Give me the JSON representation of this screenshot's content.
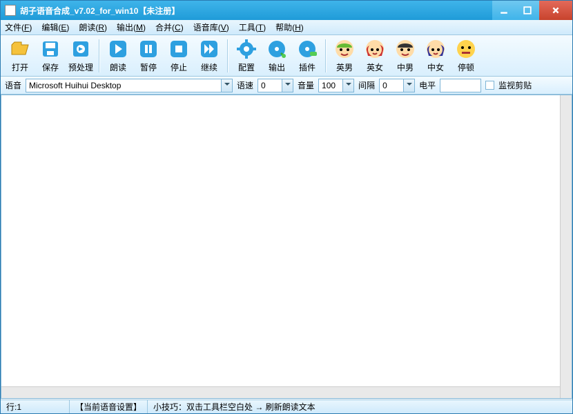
{
  "window": {
    "title": "胡子语音合成_v7.02_for_win10【未注册】"
  },
  "menu": [
    {
      "label": "文件",
      "key": "F"
    },
    {
      "label": "编辑",
      "key": "E"
    },
    {
      "label": "朗读",
      "key": "R"
    },
    {
      "label": "输出",
      "key": "M"
    },
    {
      "label": "合并",
      "key": "C"
    },
    {
      "label": "语音库",
      "key": "V"
    },
    {
      "label": "工具",
      "key": "T"
    },
    {
      "label": "帮助",
      "key": "H"
    }
  ],
  "toolbar": {
    "g1": [
      {
        "n": "打开",
        "i": "open"
      },
      {
        "n": "保存",
        "i": "save"
      },
      {
        "n": "预处理",
        "i": "pre"
      }
    ],
    "g2": [
      {
        "n": "朗读",
        "i": "play"
      },
      {
        "n": "暂停",
        "i": "pause"
      },
      {
        "n": "停止",
        "i": "stop"
      },
      {
        "n": "继续",
        "i": "next"
      }
    ],
    "g3": [
      {
        "n": "配置",
        "i": "gear"
      },
      {
        "n": "输出",
        "i": "disc-out"
      },
      {
        "n": "插件",
        "i": "disc-plug"
      }
    ],
    "g4": [
      {
        "n": "英男",
        "i": "face-m1"
      },
      {
        "n": "英女",
        "i": "face-f1"
      },
      {
        "n": "中男",
        "i": "face-m2"
      },
      {
        "n": "中女",
        "i": "face-f2"
      },
      {
        "n": "停顿",
        "i": "face-pause"
      }
    ]
  },
  "cfg": {
    "voice_label": "语音",
    "voice_value": "Microsoft Huihui Desktop",
    "speed_label": "语速",
    "speed_value": "0",
    "volume_label": "音量",
    "volume_value": "100",
    "gap_label": "间隔",
    "gap_value": "0",
    "level_label": "电平",
    "level_value": "",
    "monitor_label": "监视剪贴"
  },
  "status": {
    "line": "行:1",
    "setting": "【当前语音设置】",
    "tip": "小技巧：双击工具栏空白处 → 刷新朗读文本"
  }
}
